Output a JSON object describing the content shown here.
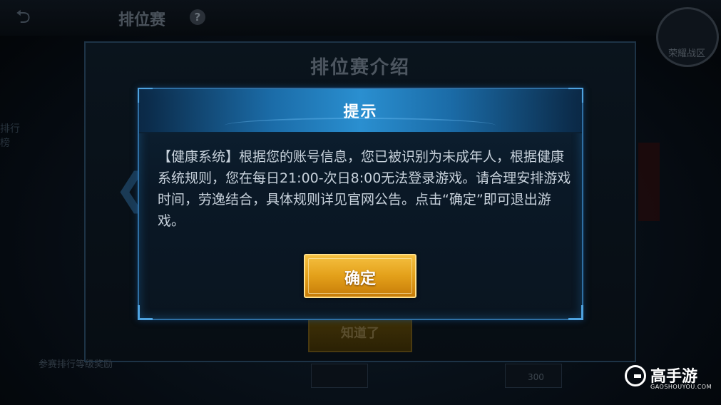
{
  "background": {
    "top_title": "排位赛",
    "help_icon_text": "?",
    "zone_label": "荣耀战区",
    "left_rank_label": "排行榜",
    "intro_panel": {
      "title": "排位赛介绍",
      "button_label": "知道了"
    },
    "footer_text": "参赛排行等级奖励",
    "footer_number": "300"
  },
  "dialog": {
    "title": "提示",
    "body": "【健康系统】根据您的账号信息，您已被识别为未成年人，根据健康系统规则，您在每日21:00-次日8:00无法登录游戏。请合理安排游戏时间，劳逸结合，具体规则详见官网公告。点击“确定”即可退出游戏。",
    "confirm_label": "确定"
  },
  "watermark": {
    "name": "高手游",
    "sub": "GAOSHOUYOU.COM"
  },
  "colors": {
    "dialog_border": "#2f6fa3",
    "header_accent": "#2a8fd0",
    "button_gold": "#e3a01a",
    "body_text": "#c8d2dc"
  },
  "icons": [
    "back-arrow-icon",
    "help-icon",
    "zone-badge-icon",
    "chevron-left-icon",
    "watermark-logo-icon"
  ]
}
